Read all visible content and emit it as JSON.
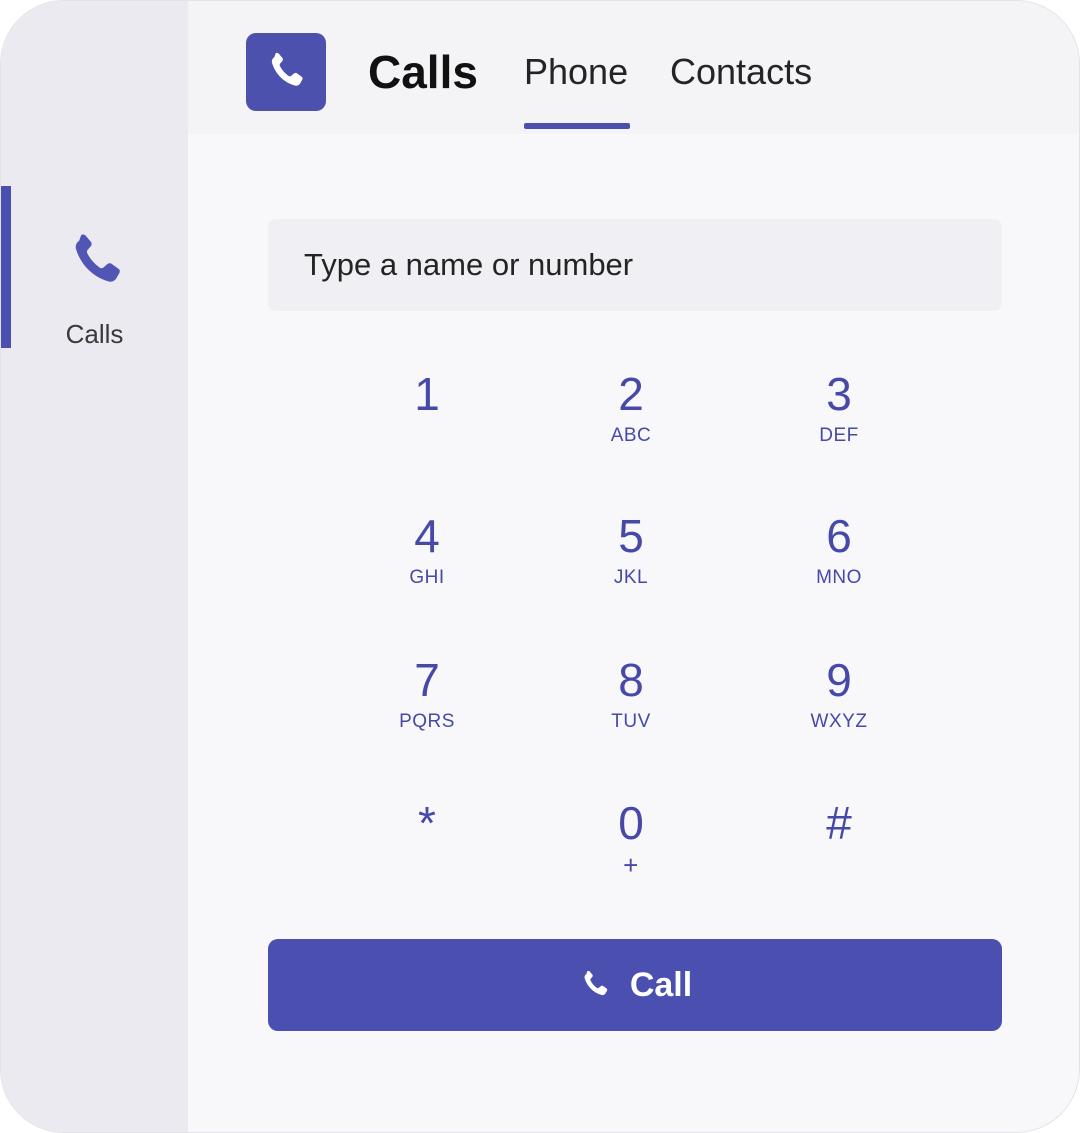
{
  "app": {
    "title": "Calls"
  },
  "colors": {
    "accent": "#4b50b0",
    "rail_bg": "#ebeaf0",
    "main_bg": "#f8f7fa"
  },
  "sidebar": {
    "items": [
      {
        "label": "Calls",
        "icon": "phone-icon",
        "active": true
      }
    ]
  },
  "header": {
    "app_icon": "phone-icon",
    "tabs": [
      {
        "label": "Phone",
        "active": true
      },
      {
        "label": "Contacts",
        "active": false
      }
    ]
  },
  "dialer": {
    "search": {
      "placeholder": "Type a name or number",
      "value": ""
    },
    "keys": [
      {
        "digit": "1",
        "letters": ""
      },
      {
        "digit": "2",
        "letters": "ABC"
      },
      {
        "digit": "3",
        "letters": "DEF"
      },
      {
        "digit": "4",
        "letters": "GHI"
      },
      {
        "digit": "5",
        "letters": "JKL"
      },
      {
        "digit": "6",
        "letters": "MNO"
      },
      {
        "digit": "7",
        "letters": "PQRS"
      },
      {
        "digit": "8",
        "letters": "TUV"
      },
      {
        "digit": "9",
        "letters": "WXYZ"
      },
      {
        "digit": "*",
        "letters": ""
      },
      {
        "digit": "0",
        "letters": "+"
      },
      {
        "digit": "#",
        "letters": ""
      }
    ],
    "call_button": {
      "label": "Call",
      "icon": "phone-icon"
    }
  }
}
